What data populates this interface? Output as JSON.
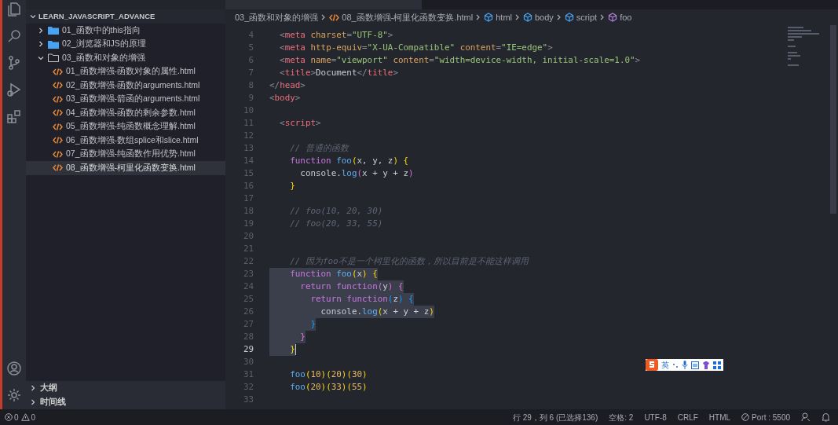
{
  "sidebar": {
    "title": "LEARN_JAVASCRIPT_ADVANCE",
    "tree": [
      {
        "kind": "folder",
        "label": "01_函数中的this指向",
        "expanded": false,
        "selected": false
      },
      {
        "kind": "folder",
        "label": "02_浏览器和JS的原理",
        "expanded": false,
        "selected": false
      },
      {
        "kind": "folder",
        "label": "03_函数和对象的增强",
        "expanded": true,
        "selected": false,
        "children": [
          {
            "kind": "file",
            "label": "01_函数增强-函数对象的属性.html",
            "selected": false
          },
          {
            "kind": "file",
            "label": "02_函数增强-函数的arguments.html",
            "selected": false
          },
          {
            "kind": "file",
            "label": "03_函数增强-箭函的arguments.html",
            "selected": false
          },
          {
            "kind": "file",
            "label": "04_函数增强-函数的剩余参数.html",
            "selected": false
          },
          {
            "kind": "file",
            "label": "05_函数增强-纯函数概念理解.html",
            "selected": false
          },
          {
            "kind": "file",
            "label": "06_函数增强-数组splice和slice.html",
            "selected": false
          },
          {
            "kind": "file",
            "label": "07_函数增强-纯函数作用优势.html",
            "selected": false
          },
          {
            "kind": "file",
            "label": "08_函数增强-柯里化函数变换.html",
            "selected": true
          }
        ]
      }
    ],
    "sections": [
      {
        "label": "大纲",
        "expanded": false
      },
      {
        "label": "时间线",
        "expanded": false
      }
    ]
  },
  "breadcrumb": [
    {
      "kind": "folder",
      "label": "03_函数和对象的增强"
    },
    {
      "kind": "file",
      "label": "08_函数增强-柯里化函数变换.html"
    },
    {
      "kind": "element",
      "label": "html"
    },
    {
      "kind": "element",
      "label": "body"
    },
    {
      "kind": "element",
      "label": "script"
    },
    {
      "kind": "method",
      "label": "foo"
    }
  ],
  "editor": {
    "lines": [
      {
        "n": "4",
        "selected": false,
        "current": false,
        "tokens": [
          {
            "kind": "p",
            "text": "  <"
          },
          {
            "kind": "tag",
            "text": "meta "
          },
          {
            "kind": "attr",
            "text": "charset"
          },
          {
            "kind": "p",
            "text": "="
          },
          {
            "kind": "str",
            "text": "\"UTF-8\""
          },
          {
            "kind": "p",
            "text": ">"
          }
        ]
      },
      {
        "n": "5",
        "selected": false,
        "current": false,
        "tokens": [
          {
            "kind": "p",
            "text": "  <"
          },
          {
            "kind": "tag",
            "text": "meta "
          },
          {
            "kind": "attr",
            "text": "http-equiv"
          },
          {
            "kind": "p",
            "text": "="
          },
          {
            "kind": "str",
            "text": "\"X-UA-Compatible\" "
          },
          {
            "kind": "attr",
            "text": "content"
          },
          {
            "kind": "p",
            "text": "="
          },
          {
            "kind": "str",
            "text": "\"IE=edge\""
          },
          {
            "kind": "p",
            "text": ">"
          }
        ]
      },
      {
        "n": "6",
        "selected": false,
        "current": false,
        "tokens": [
          {
            "kind": "p",
            "text": "  <"
          },
          {
            "kind": "tag",
            "text": "meta "
          },
          {
            "kind": "attr",
            "text": "name"
          },
          {
            "kind": "p",
            "text": "="
          },
          {
            "kind": "str",
            "text": "\"viewport\" "
          },
          {
            "kind": "attr",
            "text": "content"
          },
          {
            "kind": "p",
            "text": "="
          },
          {
            "kind": "str",
            "text": "\"width=device-width, initial-scale=1.0\""
          },
          {
            "kind": "p",
            "text": ">"
          }
        ]
      },
      {
        "n": "7",
        "selected": false,
        "current": false,
        "tokens": [
          {
            "kind": "p",
            "text": "  <"
          },
          {
            "kind": "tag",
            "text": "title"
          },
          {
            "kind": "p",
            "text": ">"
          },
          {
            "kind": "t",
            "text": "Document"
          },
          {
            "kind": "p",
            "text": "</"
          },
          {
            "kind": "tag",
            "text": "title"
          },
          {
            "kind": "p",
            "text": ">"
          }
        ]
      },
      {
        "n": "8",
        "selected": false,
        "current": false,
        "tokens": [
          {
            "kind": "p",
            "text": "</"
          },
          {
            "kind": "tag",
            "text": "head"
          },
          {
            "kind": "p",
            "text": ">"
          }
        ]
      },
      {
        "n": "9",
        "selected": false,
        "current": false,
        "tokens": [
          {
            "kind": "p",
            "text": "<"
          },
          {
            "kind": "tag",
            "text": "body"
          },
          {
            "kind": "p",
            "text": ">"
          }
        ]
      },
      {
        "n": "10",
        "selected": false,
        "current": false
      },
      {
        "n": "11",
        "selected": false,
        "current": false,
        "tokens": [
          {
            "kind": "p",
            "text": "  <"
          },
          {
            "kind": "tag",
            "text": "script"
          },
          {
            "kind": "p",
            "text": ">"
          }
        ]
      },
      {
        "n": "12",
        "selected": false,
        "current": false
      },
      {
        "n": "13",
        "selected": false,
        "current": false,
        "tokens": [
          {
            "kind": "c",
            "text": "    // 普通的函数"
          }
        ]
      },
      {
        "n": "14",
        "selected": false,
        "current": false,
        "tokens": [
          {
            "kind": "kw",
            "text": "    function "
          },
          {
            "kind": "fn",
            "text": "foo"
          },
          {
            "kind": "b1",
            "text": "("
          },
          {
            "kind": "v",
            "text": "x, y, z"
          },
          {
            "kind": "b1",
            "text": ") {"
          }
        ]
      },
      {
        "n": "15",
        "selected": false,
        "current": false,
        "tokens": [
          {
            "kind": "t",
            "text": "      console."
          },
          {
            "kind": "fn",
            "text": "log"
          },
          {
            "kind": "b2",
            "text": "("
          },
          {
            "kind": "v",
            "text": "x + y + z"
          },
          {
            "kind": "b2",
            "text": ")"
          }
        ]
      },
      {
        "n": "16",
        "selected": false,
        "current": false,
        "tokens": [
          {
            "kind": "b1",
            "text": "    }"
          }
        ]
      },
      {
        "n": "17",
        "selected": false,
        "current": false
      },
      {
        "n": "18",
        "selected": false,
        "current": false,
        "tokens": [
          {
            "kind": "c",
            "text": "    // foo(10, 20, 30)"
          }
        ]
      },
      {
        "n": "19",
        "selected": false,
        "current": false,
        "tokens": [
          {
            "kind": "c",
            "text": "    // foo(20, 33, 55)"
          }
        ]
      },
      {
        "n": "20",
        "selected": false,
        "current": false
      },
      {
        "n": "21",
        "selected": false,
        "current": false
      },
      {
        "n": "22",
        "selected": false,
        "current": false,
        "tokens": [
          {
            "kind": "c",
            "text": "    // 因为foo不是一个柯里化的函数，所以目前是不能这样调用"
          }
        ]
      },
      {
        "n": "23",
        "selected": true,
        "current": false,
        "tokens": [
          {
            "kind": "kw",
            "text": "    function "
          },
          {
            "kind": "fn",
            "text": "foo"
          },
          {
            "kind": "b1",
            "text": "("
          },
          {
            "kind": "v",
            "text": "x"
          },
          {
            "kind": "b1",
            "text": ") {"
          }
        ]
      },
      {
        "n": "24",
        "selected": true,
        "current": false,
        "tokens": [
          {
            "kind": "kw",
            "text": "      return function"
          },
          {
            "kind": "b2",
            "text": "("
          },
          {
            "kind": "v",
            "text": "y"
          },
          {
            "kind": "b2",
            "text": ") {"
          }
        ]
      },
      {
        "n": "25",
        "selected": true,
        "current": false,
        "tokens": [
          {
            "kind": "kw",
            "text": "        return function"
          },
          {
            "kind": "b3",
            "text": "("
          },
          {
            "kind": "v",
            "text": "z"
          },
          {
            "kind": "b3",
            "text": ") {"
          }
        ]
      },
      {
        "n": "26",
        "selected": true,
        "current": false,
        "tokens": [
          {
            "kind": "t",
            "text": "          console."
          },
          {
            "kind": "fn",
            "text": "log"
          },
          {
            "kind": "b1",
            "text": "("
          },
          {
            "kind": "v",
            "text": "x + y + z"
          },
          {
            "kind": "b1",
            "text": ")"
          }
        ]
      },
      {
        "n": "27",
        "selected": true,
        "current": false,
        "tokens": [
          {
            "kind": "b3",
            "text": "        }"
          }
        ]
      },
      {
        "n": "28",
        "selected": true,
        "current": false,
        "tokens": [
          {
            "kind": "b2",
            "text": "      }"
          }
        ]
      },
      {
        "n": "29",
        "selected": true,
        "current": true,
        "tokens": [
          {
            "kind": "b1",
            "text": "    }"
          }
        ]
      },
      {
        "n": "30",
        "selected": false,
        "current": false
      },
      {
        "n": "31",
        "selected": false,
        "current": false,
        "tokens": [
          {
            "kind": "fn",
            "text": "    foo"
          },
          {
            "kind": "b1",
            "text": "("
          },
          {
            "kind": "num",
            "text": "10"
          },
          {
            "kind": "b1",
            "text": ")("
          },
          {
            "kind": "num",
            "text": "20"
          },
          {
            "kind": "b1",
            "text": ")("
          },
          {
            "kind": "num",
            "text": "30"
          },
          {
            "kind": "b1",
            "text": ")"
          }
        ]
      },
      {
        "n": "32",
        "selected": false,
        "current": false,
        "tokens": [
          {
            "kind": "fn",
            "text": "    foo"
          },
          {
            "kind": "b1",
            "text": "("
          },
          {
            "kind": "num",
            "text": "20"
          },
          {
            "kind": "b1",
            "text": ")("
          },
          {
            "kind": "num",
            "text": "33"
          },
          {
            "kind": "b1",
            "text": ")("
          },
          {
            "kind": "num",
            "text": "55"
          },
          {
            "kind": "b1",
            "text": ")"
          }
        ]
      },
      {
        "n": "33",
        "selected": false,
        "current": false
      }
    ]
  },
  "ime_toolbar": {
    "label": "英"
  },
  "status_bar": {
    "errors": "0",
    "warnings": "0",
    "items": [
      {
        "kind": "text",
        "label": "行 29，列 6 (已选择136)"
      },
      {
        "kind": "text",
        "label": "空格: 2"
      },
      {
        "kind": "text",
        "label": "UTF-8"
      },
      {
        "kind": "text",
        "label": "CRLF"
      },
      {
        "kind": "text",
        "label": "HTML"
      },
      {
        "kind": "port",
        "label": "Port : 5500"
      }
    ]
  }
}
